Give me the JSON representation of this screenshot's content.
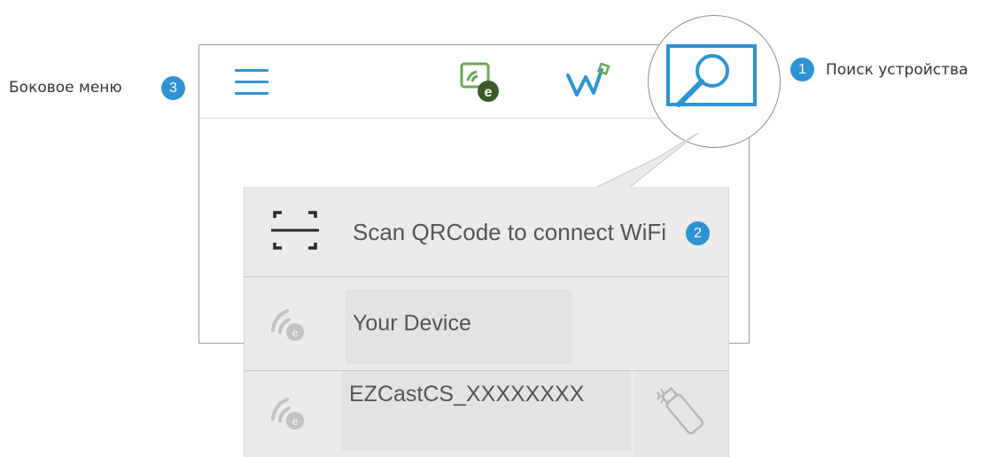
{
  "annotations": [
    {
      "number": "1",
      "label": "Поиск устройства"
    },
    {
      "number": "2",
      "label": ""
    },
    {
      "number": "3",
      "label": "Боковое меню"
    }
  ],
  "header": {
    "menu_icon": "hamburger-icon",
    "logo_icon": "ezcast-logo-icon",
    "wifi_logo_icon": "ezwire-logo-icon",
    "search_icon": "search-device-icon"
  },
  "popup": {
    "scan_label": "Scan QRCode to connect WiFi",
    "scan_icon": "qr-scan-icon",
    "device_label": "Your Device",
    "ez_label": "EZCastCS_XXXXXXXX",
    "device_icon": "wireless-icon",
    "dongle_icon": "usb-dongle-icon"
  },
  "colors": {
    "accent": "#2e93d3",
    "popup_bg": "#ebebeb",
    "logo_green": "#6aa84f",
    "logo_dark": "#3c5a2b"
  }
}
